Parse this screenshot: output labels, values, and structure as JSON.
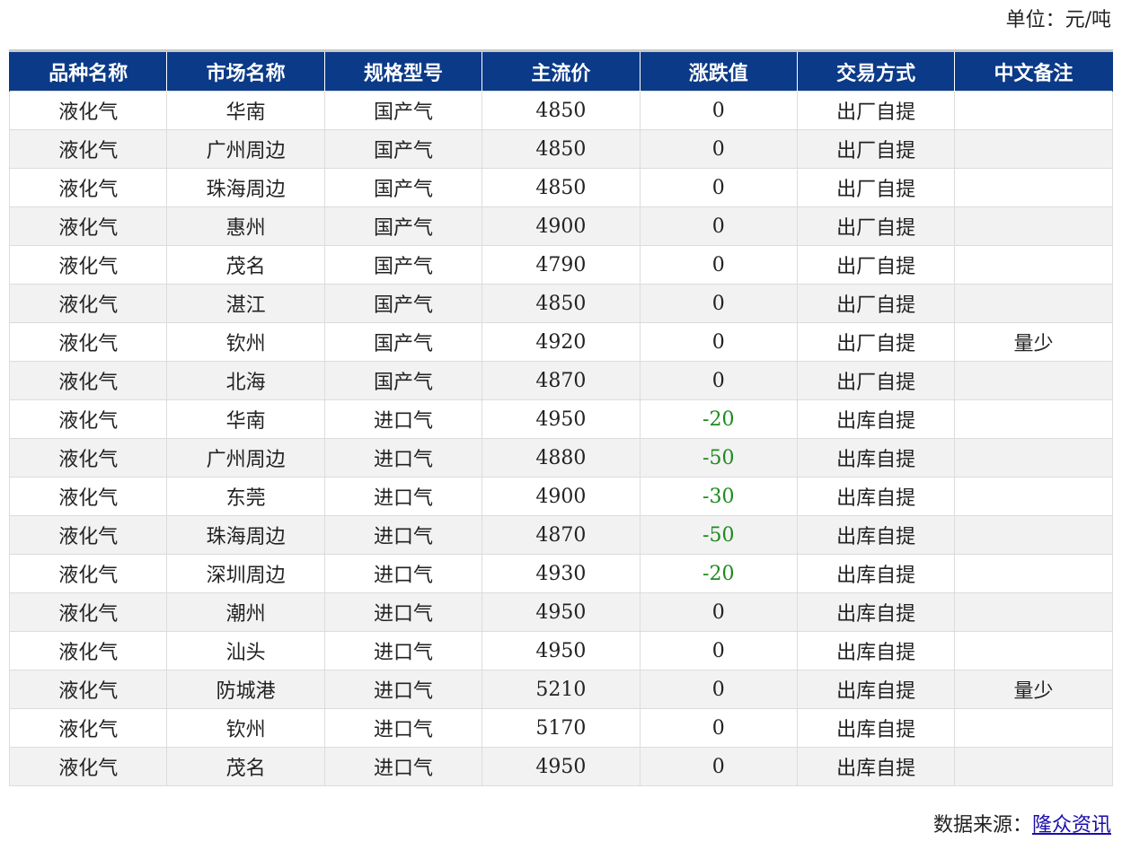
{
  "unit": {
    "label": "单位：",
    "value": "元/吨"
  },
  "table": {
    "headers": [
      "品种名称",
      "市场名称",
      "规格型号",
      "主流价",
      "涨跌值",
      "交易方式",
      "中文备注"
    ],
    "rows": [
      [
        "液化气",
        "华南",
        "国产气",
        "4850",
        "0",
        "出厂自提",
        ""
      ],
      [
        "液化气",
        "广州周边",
        "国产气",
        "4850",
        "0",
        "出厂自提",
        ""
      ],
      [
        "液化气",
        "珠海周边",
        "国产气",
        "4850",
        "0",
        "出厂自提",
        ""
      ],
      [
        "液化气",
        "惠州",
        "国产气",
        "4900",
        "0",
        "出厂自提",
        ""
      ],
      [
        "液化气",
        "茂名",
        "国产气",
        "4790",
        "0",
        "出厂自提",
        ""
      ],
      [
        "液化气",
        "湛江",
        "国产气",
        "4850",
        "0",
        "出厂自提",
        ""
      ],
      [
        "液化气",
        "钦州",
        "国产气",
        "4920",
        "0",
        "出厂自提",
        "量少"
      ],
      [
        "液化气",
        "北海",
        "国产气",
        "4870",
        "0",
        "出厂自提",
        ""
      ],
      [
        "液化气",
        "华南",
        "进口气",
        "4950",
        "-20",
        "出库自提",
        ""
      ],
      [
        "液化气",
        "广州周边",
        "进口气",
        "4880",
        "-50",
        "出库自提",
        ""
      ],
      [
        "液化气",
        "东莞",
        "进口气",
        "4900",
        "-30",
        "出库自提",
        ""
      ],
      [
        "液化气",
        "珠海周边",
        "进口气",
        "4870",
        "-50",
        "出库自提",
        ""
      ],
      [
        "液化气",
        "深圳周边",
        "进口气",
        "4930",
        "-20",
        "出库自提",
        ""
      ],
      [
        "液化气",
        "潮州",
        "进口气",
        "4950",
        "0",
        "出库自提",
        ""
      ],
      [
        "液化气",
        "汕头",
        "进口气",
        "4950",
        "0",
        "出库自提",
        ""
      ],
      [
        "液化气",
        "防城港",
        "进口气",
        "5210",
        "0",
        "出库自提",
        "量少"
      ],
      [
        "液化气",
        "钦州",
        "进口气",
        "5170",
        "0",
        "出库自提",
        ""
      ],
      [
        "液化气",
        "茂名",
        "进口气",
        "4950",
        "0",
        "出库自提",
        ""
      ]
    ]
  },
  "source": {
    "label": "数据来源：",
    "link_text": "隆众资讯"
  },
  "colors": {
    "header_bg": "#0b3a88",
    "header_text": "#ffffff",
    "negative_change": "#1e8a1e",
    "link": "#1a0dab",
    "stripe": "#f2f2f2"
  }
}
